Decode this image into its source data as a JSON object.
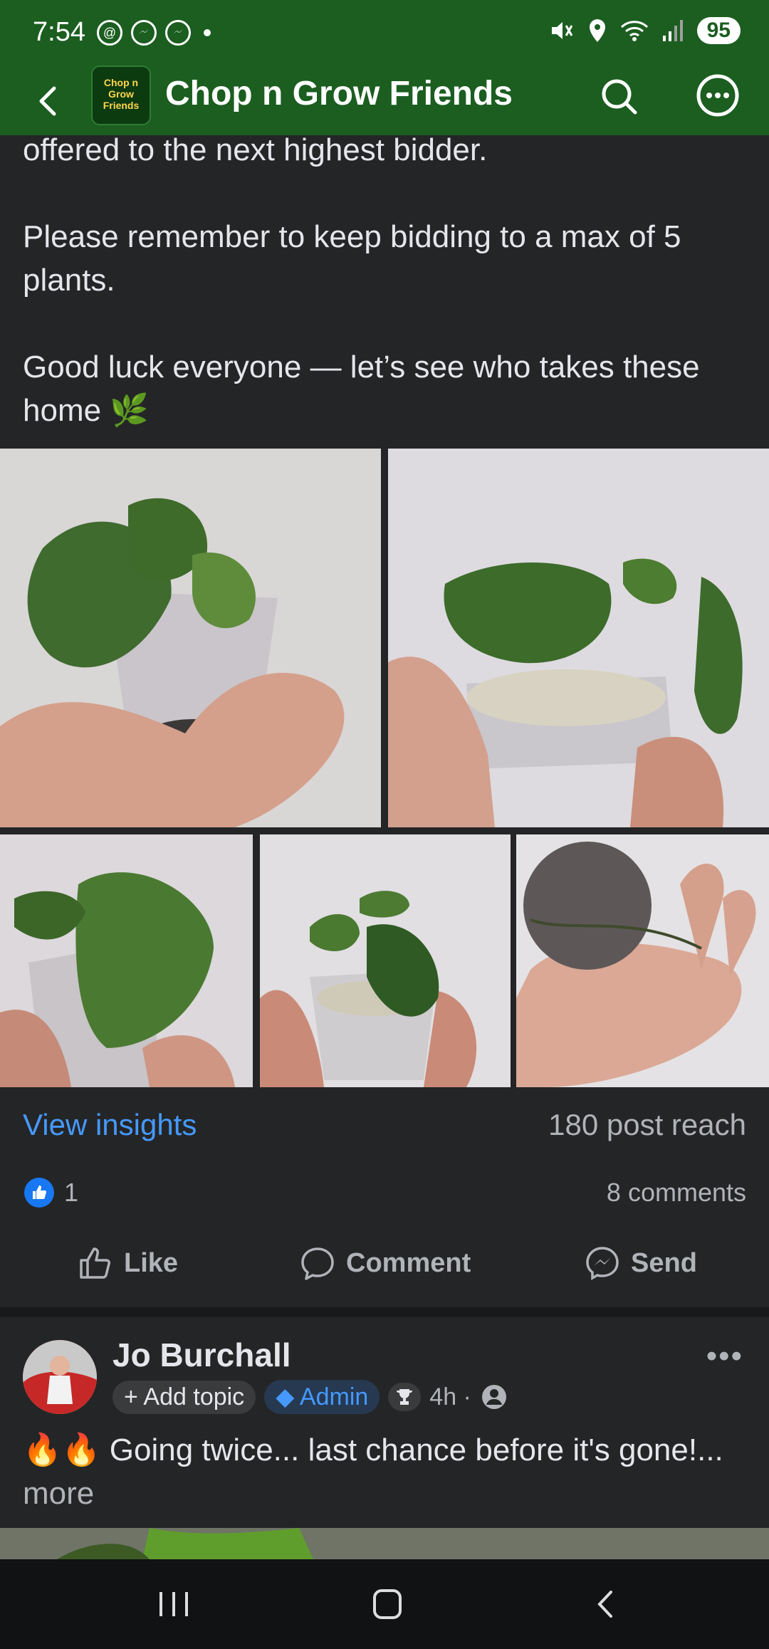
{
  "status": {
    "time": "7:54",
    "battery": "95",
    "icons": [
      "threads-icon",
      "messenger-icon",
      "messenger-icon",
      "dot",
      "mute-icon",
      "location-icon",
      "wifi-icon",
      "signal-icon"
    ]
  },
  "header": {
    "title": "Chop n Grow Friends",
    "logo_text": "Chop n Grow Friends"
  },
  "post": {
    "text_lines": [
      "offered to the next highest bidder.",
      "",
      "Please remember to keep bidding to a max of 5 plants.",
      "",
      "Good luck everyone — let’s see who takes these home 🌿"
    ],
    "insights_link": "View insights",
    "reach": "180 post reach",
    "like_count": "1",
    "comments": "8 comments",
    "actions": {
      "like": "Like",
      "comment": "Comment",
      "send": "Send"
    }
  },
  "next_post": {
    "author": "Jo Burchall",
    "add_topic": "+ Add topic",
    "admin_badge": "Admin",
    "time": "4h ·",
    "text": "🔥🔥 Going twice... last chance before it's gone!...",
    "more": "more"
  },
  "colors": {
    "header_green": "#1b5e20",
    "link_blue": "#4599ff",
    "background": "#242526"
  }
}
